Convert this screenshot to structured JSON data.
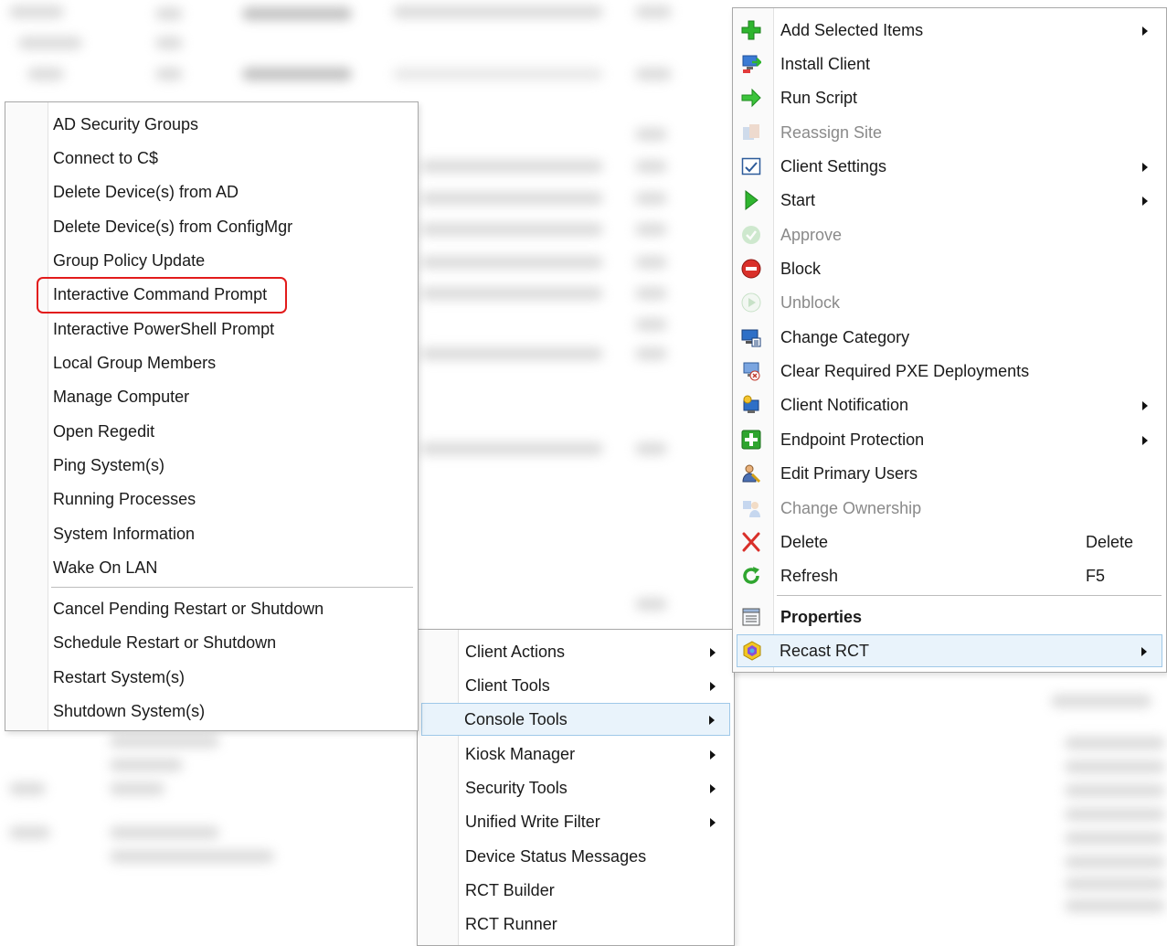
{
  "left_menu": {
    "items": [
      {
        "label": "AD Security Groups"
      },
      {
        "label": "Connect to C$"
      },
      {
        "label": "Delete Device(s) from AD"
      },
      {
        "label": "Delete Device(s) from ConfigMgr"
      },
      {
        "label": "Group Policy Update"
      },
      {
        "label": "Interactive Command Prompt"
      },
      {
        "label": "Interactive PowerShell Prompt"
      },
      {
        "label": "Local Group Members"
      },
      {
        "label": "Manage Computer"
      },
      {
        "label": "Open Regedit"
      },
      {
        "label": "Ping System(s)"
      },
      {
        "label": "Running Processes"
      },
      {
        "label": "System Information"
      },
      {
        "label": "Wake On LAN"
      },
      {
        "label": "Cancel Pending Restart or Shutdown"
      },
      {
        "label": "Schedule Restart or Shutdown"
      },
      {
        "label": "Restart System(s)"
      },
      {
        "label": "Shutdown System(s)"
      }
    ],
    "highlighted": "Interactive Command Prompt"
  },
  "middle_menu": {
    "items": [
      {
        "label": "Client Actions",
        "submenu": true
      },
      {
        "label": "Client Tools",
        "submenu": true
      },
      {
        "label": "Console Tools",
        "submenu": true,
        "active": true
      },
      {
        "label": "Kiosk Manager",
        "submenu": true
      },
      {
        "label": "Security Tools",
        "submenu": true
      },
      {
        "label": "Unified Write Filter",
        "submenu": true
      },
      {
        "label": "Device Status Messages",
        "submenu": false
      },
      {
        "label": "RCT Builder",
        "submenu": false
      },
      {
        "label": "RCT Runner",
        "submenu": false
      }
    ]
  },
  "right_menu": {
    "items": [
      {
        "label": "Add Selected Items",
        "icon": "plus-icon",
        "submenu": true
      },
      {
        "label": "Install Client",
        "icon": "install-client-icon"
      },
      {
        "label": "Run Script",
        "icon": "arrow-right-icon"
      },
      {
        "label": "Reassign Site",
        "icon": "reassign-site-icon",
        "disabled": true
      },
      {
        "label": "Client Settings",
        "icon": "client-settings-icon",
        "submenu": true
      },
      {
        "label": "Start",
        "icon": "play-icon",
        "submenu": true
      },
      {
        "label": "Approve",
        "icon": "approve-icon",
        "disabled": true
      },
      {
        "label": "Block",
        "icon": "block-icon"
      },
      {
        "label": "Unblock",
        "icon": "unblock-icon",
        "disabled": true
      },
      {
        "label": "Change Category",
        "icon": "change-category-icon"
      },
      {
        "label": "Clear Required PXE Deployments",
        "icon": "clear-pxe-icon"
      },
      {
        "label": "Client Notification",
        "icon": "client-notification-icon",
        "submenu": true
      },
      {
        "label": "Endpoint Protection",
        "icon": "endpoint-protection-icon",
        "submenu": true
      },
      {
        "label": "Edit Primary Users",
        "icon": "primary-users-icon"
      },
      {
        "label": "Change Ownership",
        "icon": "change-ownership-icon",
        "disabled": true
      },
      {
        "label": "Delete",
        "icon": "delete-x-icon",
        "shortcut": "Delete"
      },
      {
        "label": "Refresh",
        "icon": "refresh-icon",
        "shortcut": "F5"
      },
      {
        "label": "Properties",
        "icon": "properties-icon",
        "bold": true
      },
      {
        "label": "Recast RCT",
        "icon": "recast-rct-icon",
        "submenu": true,
        "active": true
      }
    ]
  },
  "colors": {
    "highlight_border": "#e21b1b",
    "hover_bg": "#e9f3fb",
    "hover_border": "#9fc8e8",
    "disabled_text": "#8a8a8a"
  }
}
